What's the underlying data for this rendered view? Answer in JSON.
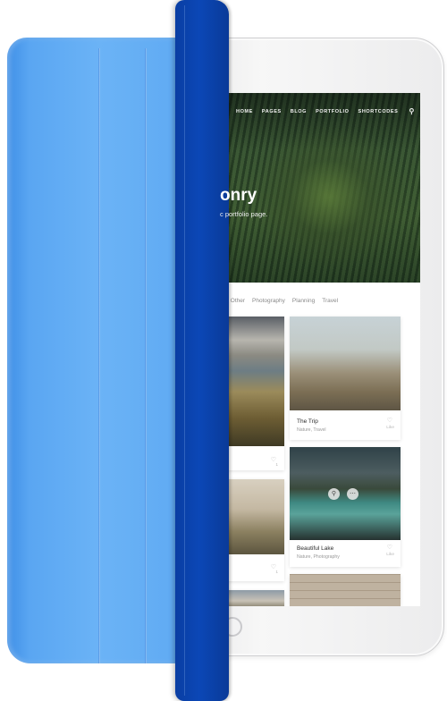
{
  "nav": {
    "items": [
      "HOME",
      "PAGES",
      "BLOG",
      "PORTFOLIO",
      "SHORTCODES"
    ],
    "search_icon": "search-icon"
  },
  "hero": {
    "title": "onry",
    "subtitle": "c portfolio page."
  },
  "filters": [
    "re",
    "Other",
    "Photography",
    "Planning",
    "Travel"
  ],
  "cards": [
    {
      "title": "The Trip",
      "category": "Nature, Travel",
      "likes": "Like"
    },
    {
      "title": "Beautiful Lake",
      "category": "Nature, Photography",
      "likes": "Like"
    }
  ],
  "left_card_likes": [
    "1",
    "1"
  ],
  "hover_icons": [
    "search-icon",
    "more-icon"
  ],
  "colors": {
    "cover_light": "#5aa6f2",
    "cover_spine": "#0b47b6",
    "device_silver": "#ececed"
  }
}
